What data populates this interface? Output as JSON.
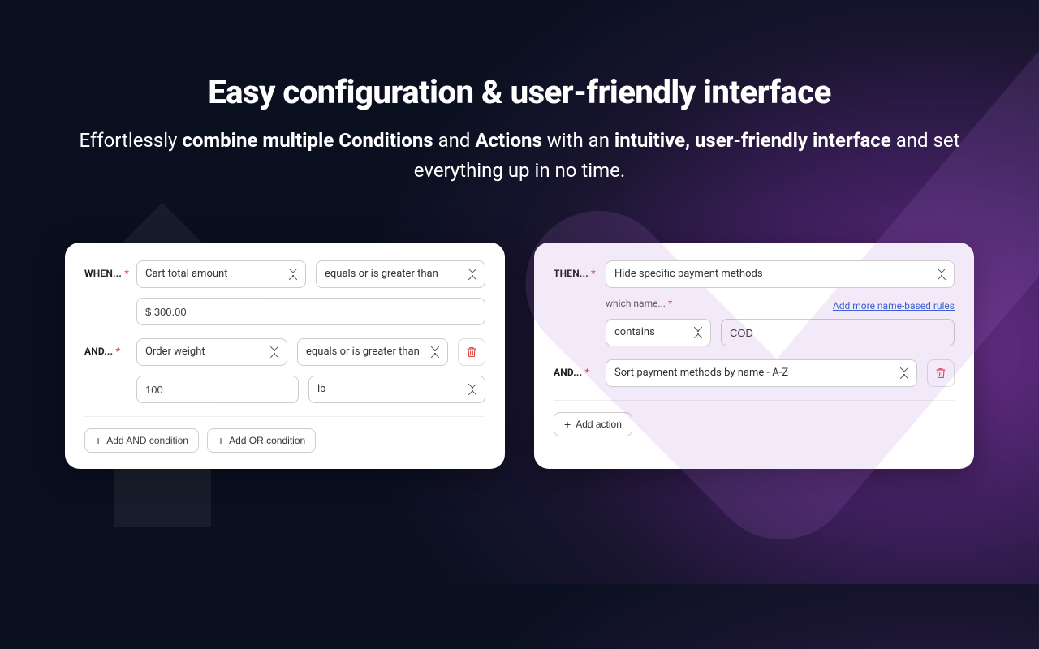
{
  "hero": {
    "title": "Easy configuration & user-friendly interface",
    "sub_pre": "Effortlessly ",
    "sub_b1": "combine multiple Conditions",
    "sub_mid1": " and ",
    "sub_b2": "Actions",
    "sub_mid2": " with an ",
    "sub_b3": "intuitive, user-friendly interface",
    "sub_post": " and set everything up in no time."
  },
  "labels": {
    "when": "WHEN...",
    "and": "AND...",
    "then": "THEN...",
    "required": "*"
  },
  "conditions_card": {
    "row1": {
      "field_select": "Cart total amount",
      "operator_select": "equals or is greater than",
      "value": "$ 300.00"
    },
    "row2": {
      "field_select": "Order weight",
      "operator_select": "equals or is greater than",
      "value": "100",
      "unit_select": "lb"
    },
    "buttons": {
      "add_and": "Add AND condition",
      "add_or": "Add OR condition"
    }
  },
  "actions_card": {
    "row1": {
      "action_select": "Hide specific payment methods",
      "which_name_label": "which name...",
      "add_rules_link": "Add more name-based rules",
      "match_select": "contains",
      "match_value": "COD"
    },
    "row2": {
      "action_select": "Sort payment methods by name - A-Z"
    },
    "buttons": {
      "add_action": "Add action"
    }
  }
}
